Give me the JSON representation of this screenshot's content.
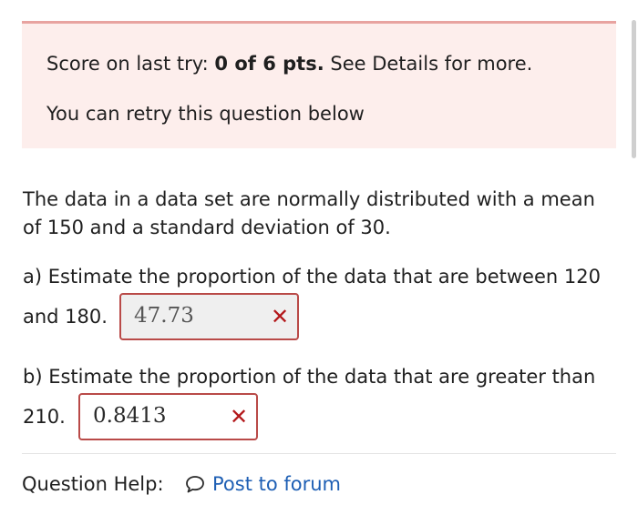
{
  "alert": {
    "score_prefix": "Score on last try: ",
    "score_value": "0 of 6 pts.",
    "score_suffix": " See Details for more.",
    "retry_text": "You can retry this question below"
  },
  "question": {
    "stem_line1": "The data in a data set are normally distributed with a mean",
    "stem_line2": "of 150 and a standard deviation of 30.",
    "part_a": {
      "line1": "a)  Estimate the proportion of the data that are between 120",
      "line2": "and 180.",
      "answer": "47.73"
    },
    "part_b": {
      "line1": "b)  Estimate the proportion of the data that are greater than",
      "line2": "210.",
      "answer": "0.8413"
    }
  },
  "help": {
    "label": "Question Help:",
    "forum_link": "Post to forum",
    "forum_icon": "speech-bubble-icon"
  },
  "icons": {
    "incorrect": "x-mark-icon"
  },
  "colors": {
    "alert_background": "#fdeeec",
    "alert_border": "#e8a3a0",
    "incorrect_border": "#b94a48",
    "incorrect_mark": "#b3181b",
    "link": "#1e5fb4"
  }
}
